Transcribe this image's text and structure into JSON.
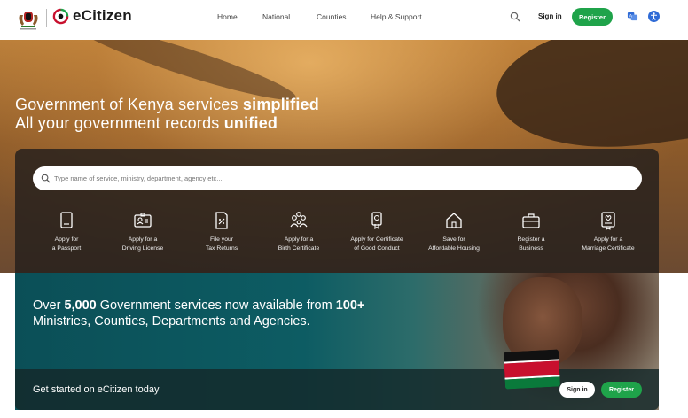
{
  "header": {
    "brand": "eCitizen",
    "nav": [
      "Home",
      "National",
      "Counties",
      "Help & Support"
    ],
    "signin_label": "Sign in",
    "register_label": "Register"
  },
  "hero": {
    "line1_regular": "Government of Kenya services ",
    "line1_bold": "simplified",
    "line2_regular": "All your government records ",
    "line2_bold": "unified",
    "search_placeholder": "Type name of service, ministry, department, agency etc..."
  },
  "services": [
    {
      "l1": "Apply for",
      "l2": "a Passport",
      "icon": "passport-icon"
    },
    {
      "l1": "Apply for a",
      "l2": "Driving License",
      "icon": "id-card-icon"
    },
    {
      "l1": "File your",
      "l2": "Tax Returns",
      "icon": "tax-document-icon"
    },
    {
      "l1": "Apply for a",
      "l2": "Birth Certificate",
      "icon": "family-icon"
    },
    {
      "l1": "Apply for Certificate",
      "l2": "of Good Conduct",
      "icon": "certificate-badge-icon"
    },
    {
      "l1": "Save for",
      "l2": "Affordable Housing",
      "icon": "house-icon"
    },
    {
      "l1": "Register a",
      "l2": "Business",
      "icon": "briefcase-icon"
    },
    {
      "l1": "Apply for a",
      "l2": "Marriage Certificate",
      "icon": "marriage-certificate-icon"
    }
  ],
  "promo": {
    "t1": "Over ",
    "t1b": "5,000",
    "t2": " Government services now available from ",
    "t2b": "100+",
    "t3": " Ministries, Counties, Departments and Agencies.",
    "cta": "Get started on eCitizen today",
    "signin_label": "Sign in",
    "register_label": "Register"
  },
  "colors": {
    "accent_green": "#1fa34a",
    "flag_black": "#111111",
    "flag_red": "#c8102e",
    "flag_green": "#0a7a3b"
  }
}
